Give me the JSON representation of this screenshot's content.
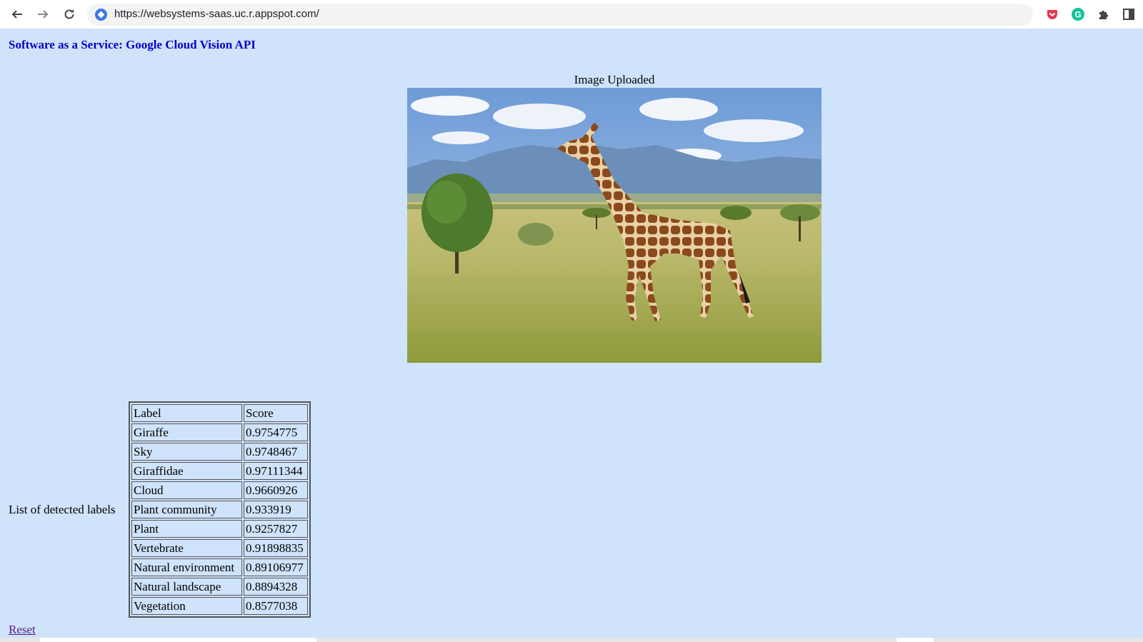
{
  "browser": {
    "url": "https://websystems-saas.uc.r.appspot.com/",
    "icons": [
      "back-arrow-icon",
      "forward-arrow-icon",
      "reload-icon",
      "site-info-icon",
      "pocket-extension-icon",
      "grammarly-extension-icon",
      "extensions-puzzle-icon",
      "side-panel-icon"
    ]
  },
  "page": {
    "title": "Software as a Service: Google Cloud Vision API",
    "image_caption": "Image Uploaded",
    "list_caption": "List of detected labels",
    "reset_label": "Reset"
  },
  "table": {
    "headers": [
      "Label",
      "Score"
    ],
    "rows": [
      [
        "Giraffe",
        "0.9754775"
      ],
      [
        "Sky",
        "0.9748467"
      ],
      [
        "Giraffidae",
        "0.97111344"
      ],
      [
        "Cloud",
        "0.9660926"
      ],
      [
        "Plant community",
        "0.933919"
      ],
      [
        "Plant",
        "0.9257827"
      ],
      [
        "Vertebrate",
        "0.91898835"
      ],
      [
        "Natural environment",
        "0.89106977"
      ],
      [
        "Natural landscape",
        "0.8894328"
      ],
      [
        "Vegetation",
        "0.8577038"
      ]
    ]
  },
  "colors": {
    "page_background": "#cfe3fb",
    "title": "#0000cc",
    "visited_link": "#551a8b"
  }
}
